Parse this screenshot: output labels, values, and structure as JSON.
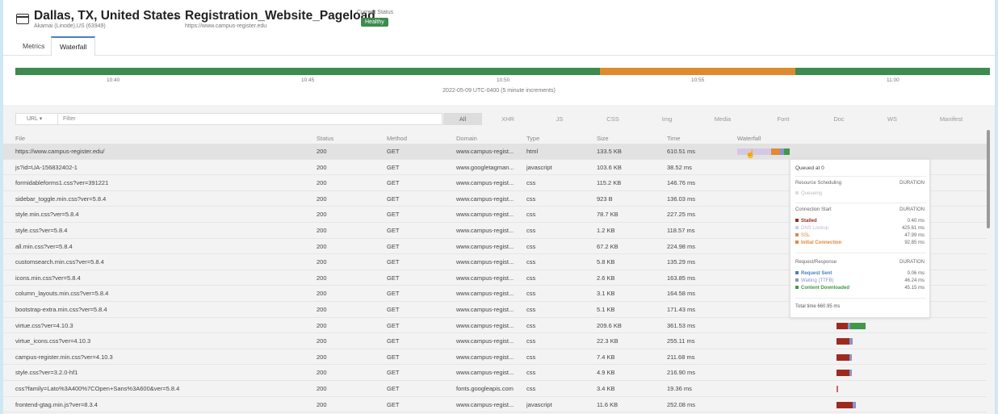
{
  "header": {
    "location_title": "Dallas, TX, United States",
    "location_sub": "Akamai (Linode),US (63949)",
    "arrow": "→",
    "test_title": "Registration_Website_Pageload",
    "test_url": "https://www.campus-register.edu",
    "status_label": "Current Status",
    "status_value": "Healthy"
  },
  "tabs": [
    {
      "label": "Metrics"
    },
    {
      "label": "Waterfall"
    }
  ],
  "timeline": {
    "ticks": [
      "10:40",
      "10:45",
      "10:50",
      "10:55",
      "11:00"
    ],
    "caption": "2022-05-09 UTC-0400 (5 minute increments)",
    "colors": {
      "healthy": "#3d8b4f",
      "warning": "#e08a2e"
    }
  },
  "filter": {
    "url_select": "URL ▾",
    "placeholder": "Filter",
    "types": [
      "All",
      "XHR",
      "JS",
      "CSS",
      "Img",
      "Media",
      "Font",
      "Doc",
      "WS",
      "Manifest"
    ]
  },
  "columns": [
    "File",
    "Status",
    "Method",
    "Domain",
    "Type",
    "Size",
    "Time",
    "Waterfall"
  ],
  "rows": [
    {
      "file": "https://www.campus-register.edu/",
      "status": "200",
      "method": "GET",
      "domain": "www.campus-regist...",
      "type": "html",
      "size": "133.5 KB",
      "time": "610.51 ms"
    },
    {
      "file": "js?id=UA-156832402-1",
      "status": "200",
      "method": "GET",
      "domain": "www.googletagman...",
      "type": "javascript",
      "size": "103.6 KB",
      "time": "38.52 ms"
    },
    {
      "file": "formidableforms1.css?ver=391221",
      "status": "200",
      "method": "GET",
      "domain": "www.campus-regist...",
      "type": "css",
      "size": "115.2 KB",
      "time": "146.76 ms"
    },
    {
      "file": "sidebar_toggle.min.css?ver=5.8.4",
      "status": "200",
      "method": "GET",
      "domain": "www.campus-regist...",
      "type": "css",
      "size": "923 B",
      "time": "136.03 ms"
    },
    {
      "file": "style.min.css?ver=5.8.4",
      "status": "200",
      "method": "GET",
      "domain": "www.campus-regist...",
      "type": "css",
      "size": "78.7 KB",
      "time": "227.25 ms"
    },
    {
      "file": "style.css?ver=5.8.4",
      "status": "200",
      "method": "GET",
      "domain": "www.campus-regist...",
      "type": "css",
      "size": "1.2 KB",
      "time": "118.57 ms"
    },
    {
      "file": "all.min.css?ver=5.8.4",
      "status": "200",
      "method": "GET",
      "domain": "www.campus-regist...",
      "type": "css",
      "size": "67.2 KB",
      "time": "224.98 ms"
    },
    {
      "file": "customsearch.min.css?ver=5.8.4",
      "status": "200",
      "method": "GET",
      "domain": "www.campus-regist...",
      "type": "css",
      "size": "5.8 KB",
      "time": "135.29 ms"
    },
    {
      "file": "icons.min.css?ver=5.8.4",
      "status": "200",
      "method": "GET",
      "domain": "www.campus-regist...",
      "type": "css",
      "size": "2.6 KB",
      "time": "163.85 ms"
    },
    {
      "file": "column_layouts.min.css?ver=5.8.4",
      "status": "200",
      "method": "GET",
      "domain": "www.campus-regist...",
      "type": "css",
      "size": "3.1 KB",
      "time": "164.58 ms"
    },
    {
      "file": "bootstrap-extra.min.css?ver=5.8.4",
      "status": "200",
      "method": "GET",
      "domain": "www.campus-regist...",
      "type": "css",
      "size": "5.1 KB",
      "time": "171.43 ms"
    },
    {
      "file": "virtue.css?ver=4.10.3",
      "status": "200",
      "method": "GET",
      "domain": "www.campus-regist...",
      "type": "css",
      "size": "209.6 KB",
      "time": "361.53 ms"
    },
    {
      "file": "virtue_icons.css?ver=4.10.3",
      "status": "200",
      "method": "GET",
      "domain": "www.campus-regist...",
      "type": "css",
      "size": "22.3 KB",
      "time": "255.11 ms"
    },
    {
      "file": "campus-register.min.css?ver=4.10.3",
      "status": "200",
      "method": "GET",
      "domain": "www.campus-regist...",
      "type": "css",
      "size": "7.4 KB",
      "time": "211.68 ms"
    },
    {
      "file": "style.css?ver=3.2.0-hf1",
      "status": "200",
      "method": "GET",
      "domain": "www.campus-regist...",
      "type": "css",
      "size": "4.9 KB",
      "time": "216.90 ms"
    },
    {
      "file": "css?family=Lato%3A400%7COpen+Sans%3A600&ver=5.8.4",
      "status": "200",
      "method": "GET",
      "domain": "fonts.googleapis.com",
      "type": "css",
      "size": "3.4 KB",
      "time": "19.36 ms"
    },
    {
      "file": "frontend-gtag.min.js?ver=8.3.4",
      "status": "200",
      "method": "GET",
      "domain": "www.campus-regist...",
      "type": "javascript",
      "size": "11.6 KB",
      "time": "252.08 ms"
    }
  ],
  "tooltip": {
    "queued": "Queued at 0",
    "resource_scheduling": "Resource Scheduling",
    "duration": "DURATION",
    "queueing": "Queueing",
    "connection_start": "Connection Start",
    "stalled": "Stalled",
    "stalled_v": "0.40 ms",
    "dns": "DNS Lookup",
    "dns_v": "425.61 ms",
    "ssl": "SSL",
    "ssl_v": "47.99 ms",
    "initial": "Initial Connection",
    "initial_v": "92.85 ms",
    "request_response": "Request/Response",
    "request_sent": "Request Sent",
    "request_sent_v": "0.06 ms",
    "waiting": "Waiting (TTFB)",
    "waiting_v": "46.24 ms",
    "content": "Content Downloaded",
    "content_v": "45.15 ms",
    "total": "Total time 660.95 ms",
    "colors": {
      "stalled": "#9e2a1f",
      "dns": "#d6c8e3",
      "ssl": "#d98a4a",
      "initial": "#e0893a",
      "request": "#4a7fc1",
      "waiting": "#8a93c9",
      "content": "#3e9a48"
    }
  }
}
